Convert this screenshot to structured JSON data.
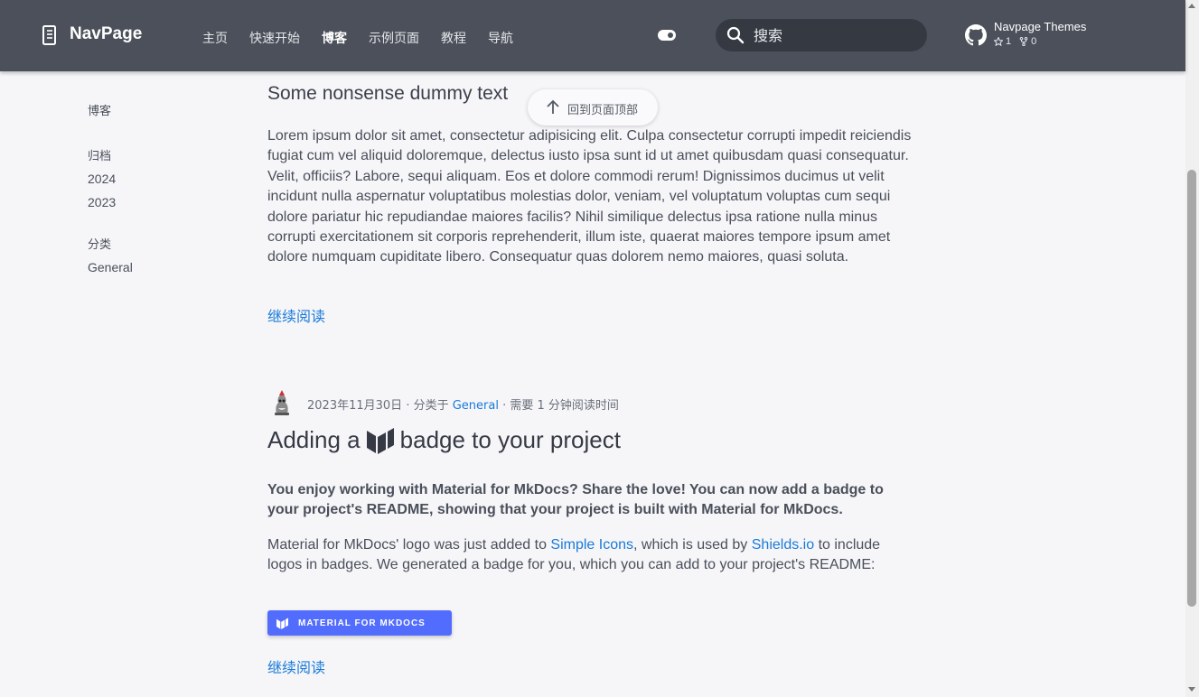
{
  "header": {
    "site_title": "NavPage",
    "nav": [
      "主页",
      "快速开始",
      "博客",
      "示例页面",
      "教程",
      "导航"
    ],
    "active_nav": "博客",
    "search_placeholder": "搜索",
    "repo_name": "Navpage Themes",
    "repo_stars": "1",
    "repo_forks": "0",
    "colors": {
      "header_bg": "#4b505a",
      "search_bg": "#353942"
    }
  },
  "sidebar": {
    "blog_title": "博客",
    "archive_title": "归档",
    "archive_links": [
      "2024",
      "2023"
    ],
    "category_title": "分类",
    "category_links": [
      "General"
    ]
  },
  "back_to_top": "回到页面顶部",
  "post1": {
    "title": "Some nonsense dummy text",
    "body": "Lorem ipsum dolor sit amet, consectetur adipisicing elit. Culpa consectetur corrupti impedit reiciendis fugiat cum vel aliquid doloremque, delectus iusto ipsa sunt id ut amet quibusdam quasi consequatur. Velit, officiis? Labore, sequi aliquam. Eos et dolore commodi rerum! Dignissimos ducimus ut velit incidunt nulla aspernatur voluptatibus molestias dolor, veniam, vel voluptatum voluptas cum sequi dolore pariatur hic repudiandae maiores facilis? Nihil similique delectus ipsa ratione nulla minus corrupti exercitationem sit corporis reprehenderit, illum iste, quaerat maiores tempore ipsum amet dolore numquam cupiditate libero. Consequatur quas dolorem nemo maiores, quasi soluta.",
    "read_more": "继续阅读"
  },
  "post2": {
    "date": "2023年11月30日",
    "category_prefix": "· 分类于 ",
    "category": "General",
    "read_time": "· 需要 1 分钟阅读时间",
    "title_before": "Adding a",
    "title_after": "badge to your project",
    "lead": "You enjoy working with Material for MkDocs? Share the love! You can now add a badge to your project's README, showing that your project is built with Material for MkDocs.",
    "body_1": "Material for MkDocs' logo was just added to ",
    "link_1": "Simple Icons",
    "body_2": ", which is used by ",
    "link_2": "Shields.io",
    "body_3": " to include logos in badges. We generated a badge for you, which you can add to your project's README:",
    "badge": "MATERIAL FOR MKDOCS",
    "badge_color": "#526cfe",
    "read_more": "继续阅读"
  },
  "link_color": "#1a7ad8"
}
